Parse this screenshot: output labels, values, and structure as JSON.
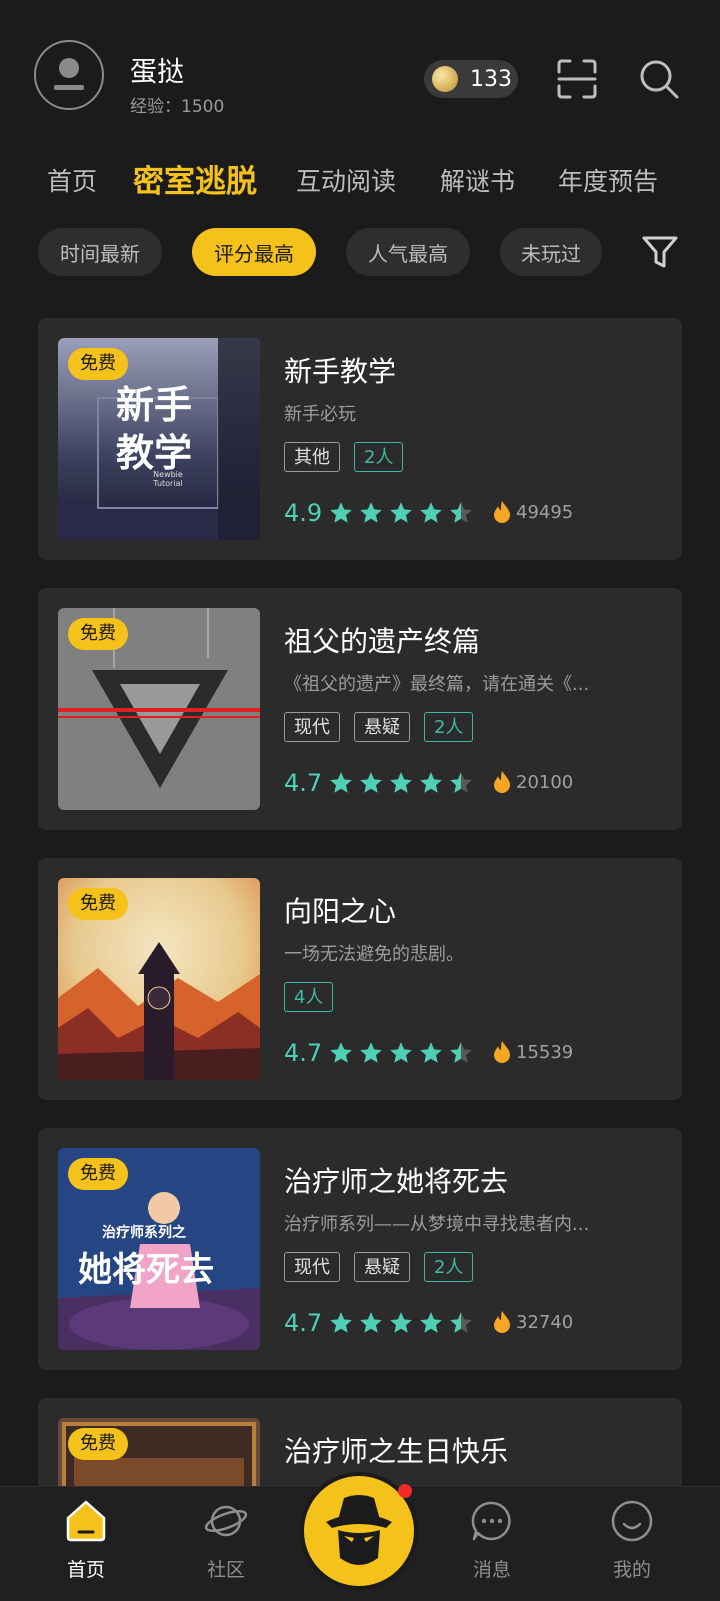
{
  "header": {
    "username": "蛋挞",
    "exp_label": "经验：",
    "exp_value": "1500",
    "coins": "133"
  },
  "tabs": [
    {
      "label": "首页"
    },
    {
      "label": "密室逃脱"
    },
    {
      "label": "互动阅读"
    },
    {
      "label": "解谜书"
    },
    {
      "label": "年度预告"
    }
  ],
  "filters": [
    {
      "label": "时间最新"
    },
    {
      "label": "评分最高"
    },
    {
      "label": "人气最高"
    },
    {
      "label": "未玩过"
    }
  ],
  "games": [
    {
      "free": "免费",
      "title": "新手教学",
      "desc": "新手必玩",
      "tags": [
        "其他",
        "2人"
      ],
      "score": "4.9",
      "rating": 4.5,
      "heat": "49495",
      "cover_text1": "新手",
      "cover_text2": "教学",
      "cover_sub": "Newbie Tutorial"
    },
    {
      "free": "免费",
      "title": "祖父的遗产终篇",
      "desc": "《祖父的遗产》最终篇，请在通关《...",
      "tags": [
        "现代",
        "悬疑",
        "2人"
      ],
      "score": "4.7",
      "rating": 4.5,
      "heat": "20100"
    },
    {
      "free": "免费",
      "title": "向阳之心",
      "desc": "一场无法避免的悲剧。",
      "tags": [
        "4人"
      ],
      "score": "4.7",
      "rating": 4.5,
      "heat": "15539"
    },
    {
      "free": "免费",
      "title": "治疗师之她将死去",
      "desc": "治疗师系列——从梦境中寻找患者内...",
      "tags": [
        "现代",
        "悬疑",
        "2人"
      ],
      "score": "4.7",
      "rating": 4.5,
      "heat": "32740",
      "cover_text": "她将死去",
      "cover_sub": "治疗师系列之"
    },
    {
      "free": "免费",
      "title": "治疗师之生日快乐"
    }
  ],
  "nav": [
    {
      "label": "首页"
    },
    {
      "label": "社区"
    },
    {
      "label": "消息"
    },
    {
      "label": "我的"
    }
  ],
  "colors": {
    "accent": "#f5c21b",
    "score": "#4fd0b6",
    "tag_green": "#3fb9a3",
    "background": "#1b1b1b",
    "card": "#2b2b2b"
  }
}
